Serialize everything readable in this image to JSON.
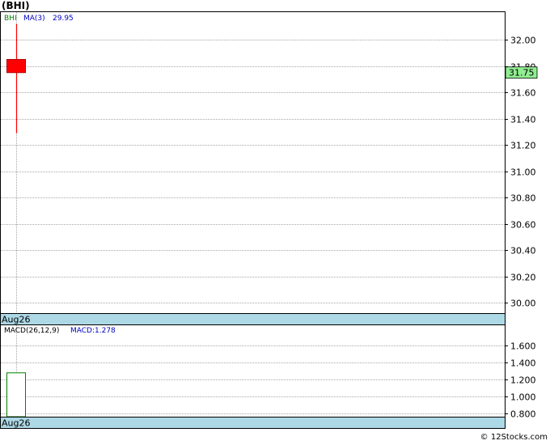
{
  "title": "(BHI)",
  "watermark": "© 12Stocks.com",
  "colors": {
    "grid": "#a8a8a8",
    "axis_band": "#add8e6",
    "candle_down": "#ff0000",
    "ma_label": "#0000c0",
    "ticker_label": "#008000",
    "price_tag_bg": "#90ee90",
    "macd_bar_stroke": "#008000",
    "frame": "#000000"
  },
  "chart_data": [
    {
      "type": "candlestick",
      "name": "price",
      "ticker": "BHI",
      "ma_label": "MA(3)",
      "ma_value": "29.95",
      "dates": [
        "Aug26"
      ],
      "ohlc": [
        {
          "date": "Aug26",
          "open": 31.85,
          "high": 32.12,
          "low": 31.29,
          "close": 31.75
        }
      ],
      "last_price": "31.75",
      "ylim": [
        29.92,
        32.21
      ],
      "yticks": [
        32.0,
        31.8,
        31.6,
        31.4,
        31.2,
        31.0,
        30.8,
        30.6,
        30.4,
        30.2,
        30.0
      ],
      "ytick_labels": [
        "32.00",
        "31.80",
        "31.60",
        "31.40",
        "31.20",
        "31.00",
        "30.80",
        "30.60",
        "30.40",
        "30.20",
        "30.00"
      ],
      "grid": true
    },
    {
      "type": "bar",
      "name": "macd",
      "label": "MACD(26,12,9)",
      "value_label": "MACD:1.278",
      "dates": [
        "Aug26"
      ],
      "values": [
        1.278
      ],
      "ylim": [
        0.76,
        1.84
      ],
      "yticks": [
        1.6,
        1.4,
        1.2,
        1.0,
        0.8
      ],
      "ytick_labels": [
        "1.600",
        "1.400",
        "1.200",
        "1.000",
        "0.800"
      ],
      "grid": true
    }
  ]
}
